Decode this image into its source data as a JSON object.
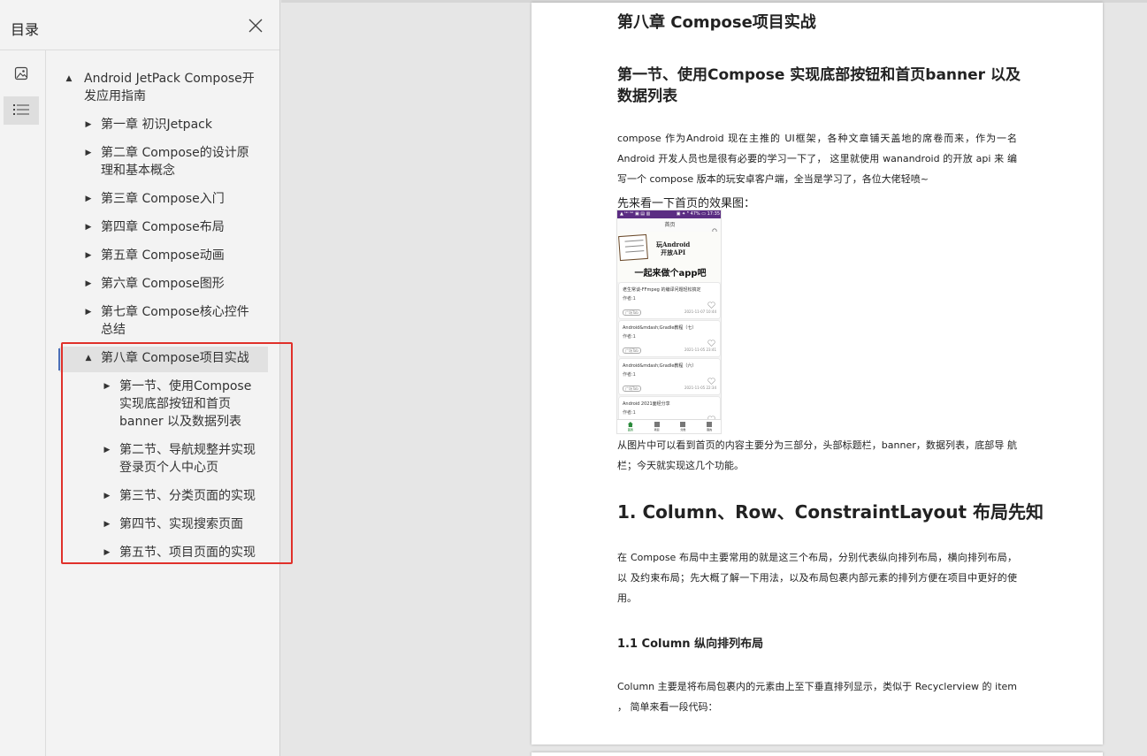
{
  "sidebar": {
    "title": "目录",
    "toc": {
      "root": "Android JetPack Compose开发应用指南",
      "chapters": [
        "第一章 初识Jetpack",
        "第二章 Compose的设计原理和基本概念",
        "第三章 Compose入门",
        "第四章 Compose布局",
        "第五章 Compose动画",
        "第六章 Compose图形",
        "第七章 Compose核心控件总结",
        "第八章 Compose项目实战"
      ],
      "sections": [
        "第一节、使用Compose 实现底部按钮和首页 banner 以及数据列表",
        "第二节、导航规整并实现登录页个人中心页",
        "第三节、分类页面的实现",
        "第四节、实现搜索页面",
        "第五节、项目页面的实现"
      ]
    },
    "rail": [
      "thumbnail-view-icon",
      "outline-view-icon"
    ],
    "highlight_color": "#e0302a"
  },
  "document": {
    "chapter_title": "第八章 Compose项目实战",
    "section_title": "第一节、使用Compose 实现底部按钮和首页banner 以及数据列表",
    "intro_paragraph": "compose 作为Android 现在主推的 UI框架，各种文章铺天盖地的席卷而来，作为一名 Android 开发人员也是很有必要的学习一下了， 这里就使用 wanandroid 的开放 api 来 编写一个 compose 版本的玩安卓客户端，全当是学习了，各位大佬轻喷~",
    "intro_lead": "先来看一下首页的效果图：",
    "after_image": "从图片中可以看到首页的内容主要分为三部分，头部标题栏，banner，数据列表，底部导 航 栏；今天就实现这几个功能。",
    "h_column_row": "1. Column、Row、ConstraintLayout 布局先知",
    "p_layouts": "在 Compose 布局中主要常用的就是这三个布局，分别代表纵向排列布局，横向排列布局，以 及约束布局；先大概了解一下用法，以及布局包裹内部元素的排列方便在项目中更好的使 用。",
    "h_column": "1.1 Column 纵向排列布局",
    "p_column": "Column 主要是将布局包裹内的元素由上至下垂直排列显示，类似于 Recyclerview 的 item ， 简单来看一段代码："
  },
  "phone": {
    "status_left": "▲ ᴵᵃᶦ ᴵᵃᶦ ▣ ▤ ▥",
    "status_right": "▣ ✦ ᴿ 47% ▭ 17:35",
    "title": "首页",
    "banner_api": "玩Android\n开放API",
    "banner_slogan": "一起来做个app吧",
    "cards": [
      {
        "title": "老生常谈-FFmpeg 的编译问题轻松搞定",
        "author": "作者:1",
        "tag": "广场Tab",
        "date": "2021-11-07 10:44"
      },
      {
        "title": "Android&mdash;Gradle教程（七）",
        "author": "作者:1",
        "tag": "广场Tab",
        "date": "2021-11-05 23:41"
      },
      {
        "title": "Android&mdash;Gradle教程（六）",
        "author": "作者:1",
        "tag": "广场Tab",
        "date": "2021-11-05 22:34"
      },
      {
        "title": "Android 2021面经分享",
        "author": "作者:1",
        "tag": "",
        "date": ""
      }
    ],
    "nav": [
      "首页",
      "项目",
      "分类",
      "我的"
    ]
  }
}
